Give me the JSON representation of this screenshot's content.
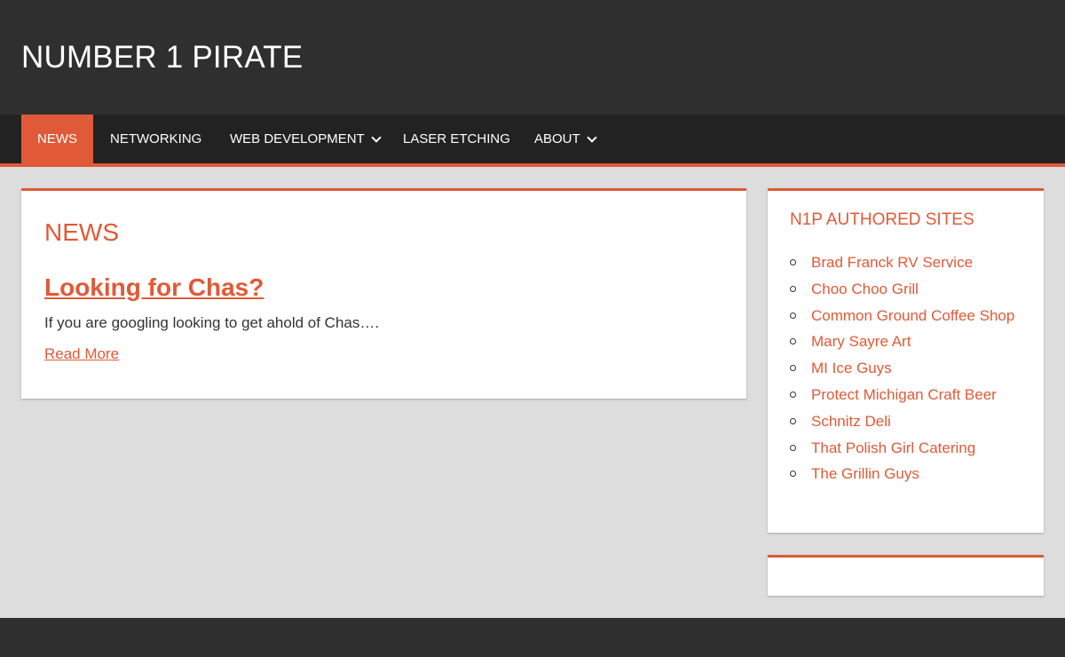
{
  "site": {
    "title": "NUMBER 1 PIRATE"
  },
  "nav": {
    "items": [
      {
        "label": "NEWS",
        "active": true,
        "has_dropdown": false
      },
      {
        "label": "NETWORKING",
        "has_dropdown": false
      },
      {
        "label": "WEB DEVELOPMENT",
        "has_dropdown": true
      },
      {
        "label": "LASER ETCHING",
        "has_dropdown": false
      },
      {
        "label": "ABOUT",
        "has_dropdown": true
      }
    ]
  },
  "main": {
    "heading": "NEWS",
    "post": {
      "title": "Looking for Chas?",
      "excerpt": "If you are googling looking to get ahold of Chas….",
      "read_more": "Read More"
    }
  },
  "sidebar": {
    "widget_title": "N1P AUTHORED SITES",
    "links": [
      "Brad Franck RV Service",
      "Choo Choo Grill",
      "Common Ground Coffee Shop",
      "Mary Sayre Art",
      "MI Ice Guys",
      "Protect Michigan Craft Beer",
      "Schnitz Deli",
      "That Polish Girl Catering",
      "The Grillin Guys"
    ]
  },
  "colors": {
    "accent": "#e05a37",
    "header_bg": "#2f2f2f",
    "nav_bg": "#222222",
    "page_bg": "#dddddd"
  }
}
